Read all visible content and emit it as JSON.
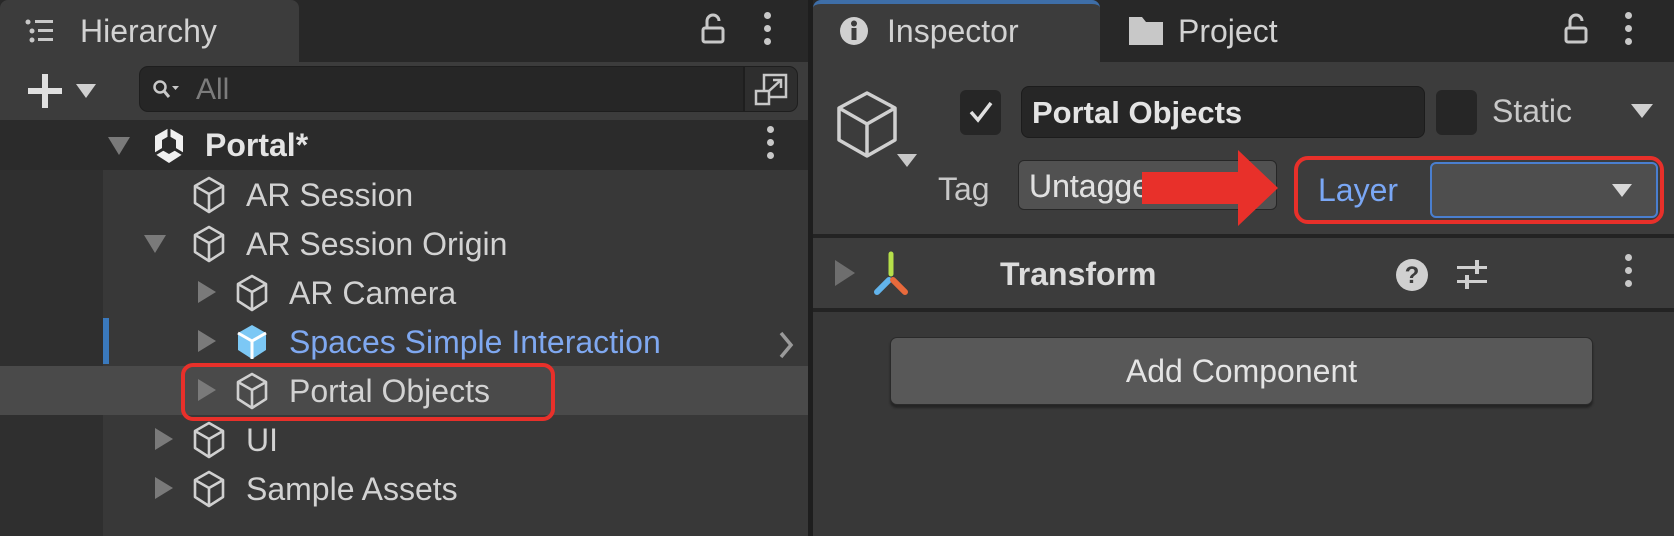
{
  "hierarchy": {
    "tab_label": "Hierarchy",
    "search_placeholder": "All",
    "scene": {
      "label": "Portal*"
    },
    "items": [
      {
        "label": "AR Session",
        "level": 1,
        "expandable": false
      },
      {
        "label": "AR Session Origin",
        "level": 1,
        "expandable": true,
        "expanded": true
      },
      {
        "label": "AR Camera",
        "level": 2,
        "expandable": true
      },
      {
        "label": "Spaces Simple Interaction",
        "level": 2,
        "expandable": true,
        "prefab": true
      },
      {
        "label": "Portal Objects",
        "level": 2,
        "expandable": true,
        "selected": true,
        "highlighted": true
      },
      {
        "label": "UI",
        "level": 1,
        "expandable": true
      },
      {
        "label": "Sample Assets",
        "level": 1,
        "expandable": true
      }
    ]
  },
  "inspector": {
    "tabs": [
      {
        "label": "Inspector",
        "icon": "info-icon",
        "active": true
      },
      {
        "label": "Project",
        "icon": "folder-icon"
      }
    ],
    "object_name": "Portal Objects",
    "active_checked": true,
    "static_label": "Static",
    "static_checked": false,
    "tag_label": "Tag",
    "tag_value": "Untagged",
    "tag_visible_text": "Untagg",
    "layer_label": "Layer",
    "layer_value": "",
    "component": {
      "label": "Transform"
    },
    "add_component_label": "Add Component"
  },
  "colors": {
    "accent_red": "#e8302a",
    "prefab_blue": "#7fa8f0",
    "layer_blue": "#7aa7f5",
    "selection": "#4a4a4a"
  }
}
